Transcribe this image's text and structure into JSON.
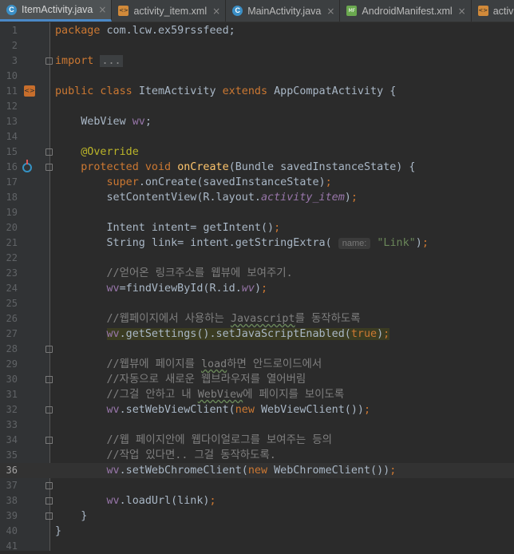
{
  "tabs": [
    {
      "label": "ItemActivity.java",
      "icon": "java-class-icon",
      "active": true
    },
    {
      "label": "activity_item.xml",
      "icon": "xml-file-icon",
      "active": false
    },
    {
      "label": "MainActivity.java",
      "icon": "java-class-icon",
      "active": false
    },
    {
      "label": "AndroidManifest.xml",
      "icon": "manifest-file-icon",
      "active": false
    },
    {
      "label": "activity",
      "icon": "xml-file-icon",
      "active": false
    }
  ],
  "current_line": 36,
  "lines": [
    {
      "n": "1",
      "t": [
        [
          "kw",
          "package "
        ],
        [
          "",
          "com.lcw.ex59rssfeed;"
        ]
      ]
    },
    {
      "n": "2",
      "t": []
    },
    {
      "n": "3",
      "t": [
        [
          "kw",
          "import "
        ],
        [
          "dots",
          "..."
        ]
      ]
    },
    {
      "n": "10",
      "t": []
    },
    {
      "n": "11",
      "t": [
        [
          "kw",
          "public class "
        ],
        [
          "",
          "ItemActivity "
        ],
        [
          "kw",
          "extends "
        ],
        [
          "",
          "AppCompatActivity {"
        ]
      ]
    },
    {
      "n": "12",
      "t": []
    },
    {
      "n": "13",
      "t": [
        [
          "",
          "    WebView "
        ],
        [
          "fld",
          "wv"
        ],
        [
          "",
          ";"
        ]
      ]
    },
    {
      "n": "14",
      "t": []
    },
    {
      "n": "15",
      "t": [
        [
          "ann",
          "    @Override"
        ]
      ]
    },
    {
      "n": "16",
      "t": [
        [
          "kw",
          "    protected void "
        ],
        [
          "fn",
          "onCreate"
        ],
        [
          "",
          "(Bundle savedInstanceState) {"
        ]
      ]
    },
    {
      "n": "17",
      "t": [
        [
          "kw",
          "        super"
        ],
        [
          "",
          ".onCreate(savedInstanceState)"
        ],
        [
          "kw",
          ";"
        ]
      ]
    },
    {
      "n": "18",
      "t": [
        [
          "",
          "        setContentView(R.layout."
        ],
        [
          "ital",
          "activity_item"
        ],
        [
          "",
          ")"
        ],
        [
          "kw",
          ";"
        ]
      ]
    },
    {
      "n": "19",
      "t": []
    },
    {
      "n": "20",
      "t": [
        [
          "",
          "        Intent intent= getIntent()"
        ],
        [
          "kw",
          ";"
        ]
      ]
    },
    {
      "n": "21",
      "t": [
        [
          "",
          "        String link= intent.getStringExtra( "
        ],
        [
          "hint",
          "name:"
        ],
        [
          "str",
          " \"Link\""
        ],
        [
          "",
          ")"
        ],
        [
          "kw",
          ";"
        ]
      ]
    },
    {
      "n": "22",
      "t": []
    },
    {
      "n": "23",
      "t": [
        [
          "cm",
          "        //얻어온 링크주소를 웹뷰에 보여주기."
        ]
      ]
    },
    {
      "n": "24",
      "t": [
        [
          "",
          "        "
        ],
        [
          "fld",
          "wv"
        ],
        [
          "",
          "=findViewById(R.id."
        ],
        [
          "ital",
          "wv"
        ],
        [
          "",
          ")"
        ],
        [
          "kw",
          ";"
        ]
      ]
    },
    {
      "n": "25",
      "t": []
    },
    {
      "n": "26",
      "t": [
        [
          "cm",
          "        //웹페이지에서 사용하는 Javascript를 동작하도록"
        ]
      ]
    },
    {
      "n": "27",
      "t": [
        [
          "",
          "        "
        ],
        [
          "hlfld",
          "wv"
        ],
        [
          "hl",
          ".getSettings().setJavaScriptEnabled("
        ],
        [
          "hlkw",
          "true"
        ],
        [
          "hl",
          ")"
        ],
        [
          "hlkw",
          ";"
        ]
      ]
    },
    {
      "n": "28",
      "t": []
    },
    {
      "n": "29",
      "t": [
        [
          "cm",
          "        //웹뷰에 페이지를 load하면 안드로이드에서"
        ]
      ]
    },
    {
      "n": "30",
      "t": [
        [
          "cm",
          "        //자동으로 새로운 웹브라우저를 열어버림"
        ]
      ]
    },
    {
      "n": "31",
      "t": [
        [
          "cm",
          "        //그걸 안하고 내 WebView에 페이지를 보이도록"
        ]
      ]
    },
    {
      "n": "32",
      "t": [
        [
          "",
          "        "
        ],
        [
          "fld",
          "wv"
        ],
        [
          "",
          ".setWebViewClient("
        ],
        [
          "kw",
          "new "
        ],
        [
          "",
          "WebViewClient())"
        ],
        [
          "kw",
          ";"
        ]
      ]
    },
    {
      "n": "33",
      "t": []
    },
    {
      "n": "34",
      "t": [
        [
          "cm",
          "        //웹 페이지안에 웹다이얼로그를 보여주는 등의"
        ]
      ]
    },
    {
      "n": "35",
      "t": [
        [
          "cm",
          "        //작업 있다면.. 그걸 동작하도록."
        ]
      ]
    },
    {
      "n": "36",
      "t": [
        [
          "",
          "        "
        ],
        [
          "fld",
          "wv"
        ],
        [
          "",
          ".setWebChromeClient("
        ],
        [
          "kw",
          "new "
        ],
        [
          "",
          "WebChromeClient())"
        ],
        [
          "kw",
          ";"
        ]
      ]
    },
    {
      "n": "37",
      "t": []
    },
    {
      "n": "38",
      "t": [
        [
          "",
          "        "
        ],
        [
          "fld",
          "wv"
        ],
        [
          "",
          ".loadUrl(link)"
        ],
        [
          "kw",
          ";"
        ]
      ]
    },
    {
      "n": "39",
      "t": [
        [
          "",
          "    }"
        ]
      ]
    },
    {
      "n": "40",
      "t": [
        [
          "",
          "}"
        ]
      ]
    },
    {
      "n": "41",
      "t": []
    }
  ]
}
